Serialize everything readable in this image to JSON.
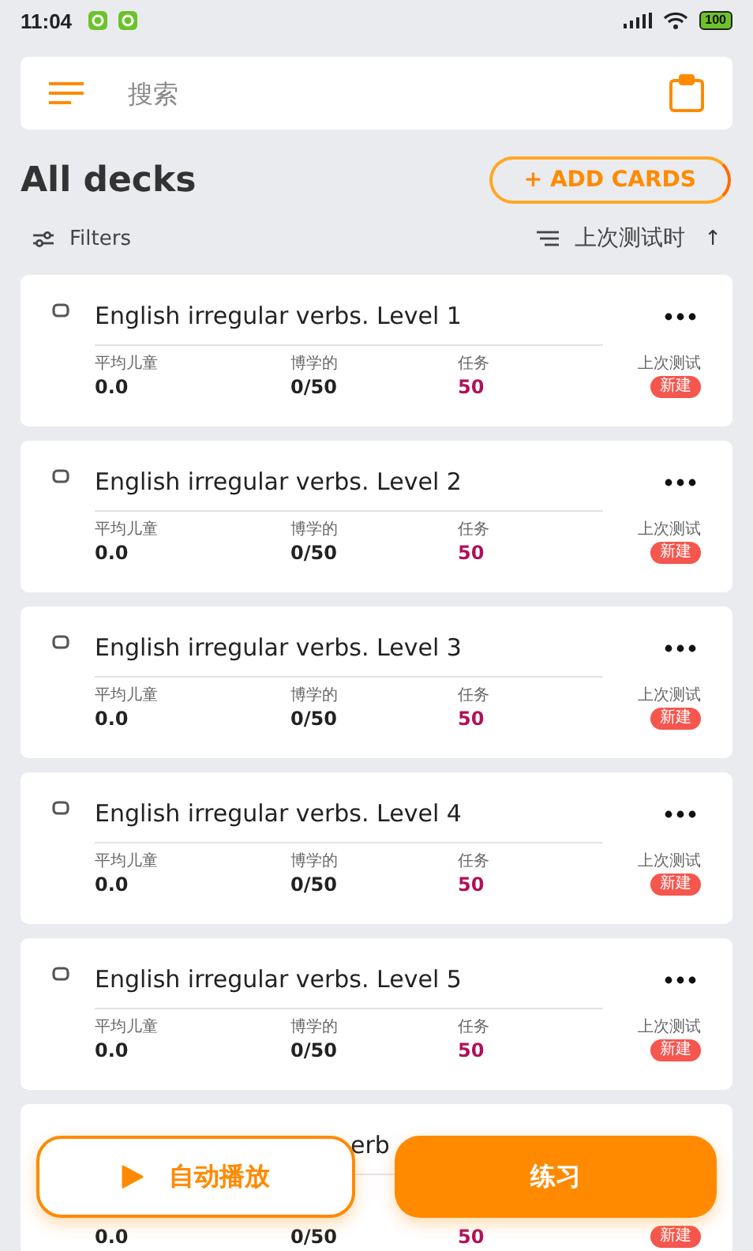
{
  "status_bar": {
    "time": "11:04",
    "battery": "100"
  },
  "search": {
    "placeholder": "搜索"
  },
  "header": {
    "title": "All decks",
    "add_button": "+ ADD CARDS"
  },
  "toolbar": {
    "filters": "Filters",
    "sort": "上次测试时",
    "sort_direction": "↑"
  },
  "decks": [
    {
      "kind": "full",
      "title": "English irregular verbs. Level 1",
      "stats": [
        {
          "label": "平均儿童",
          "value": "0.0"
        },
        {
          "label": "博学的",
          "value": "0/50"
        },
        {
          "label": "任务",
          "value": "50"
        }
      ],
      "last_label": "上次测试",
      "last_badge": "新建"
    },
    {
      "kind": "full",
      "title": "English irregular verbs. Level 2",
      "stats": [
        {
          "label": "平均儿童",
          "value": "0.0"
        },
        {
          "label": "博学的",
          "value": "0/50"
        },
        {
          "label": "任务",
          "value": "50"
        }
      ],
      "last_label": "上次测试",
      "last_badge": "新建"
    },
    {
      "kind": "full",
      "title": "English irregular verbs. Level 3",
      "stats": [
        {
          "label": "平均儿童",
          "value": "0.0"
        },
        {
          "label": "博学的",
          "value": "0/50"
        },
        {
          "label": "任务",
          "value": "50"
        }
      ],
      "last_label": "上次测试",
      "last_badge": "新建"
    },
    {
      "kind": "full",
      "title": "English irregular verbs. Level 4",
      "stats": [
        {
          "label": "平均儿童",
          "value": "0.0"
        },
        {
          "label": "博学的",
          "value": "0/50"
        },
        {
          "label": "任务",
          "value": "50"
        }
      ],
      "last_label": "上次测试",
      "last_badge": "新建"
    },
    {
      "kind": "full",
      "title": "English irregular verbs. Level 5",
      "stats": [
        {
          "label": "平均儿童",
          "value": "0.0"
        },
        {
          "label": "博学的",
          "value": "0/50"
        },
        {
          "label": "任务",
          "value": "50"
        }
      ],
      "last_label": "上次测试",
      "last_badge": "新建"
    },
    {
      "kind": "partial",
      "title": "erb",
      "stats": [
        {
          "value": "0.0"
        },
        {
          "value": "0/50"
        },
        {
          "value": "50"
        }
      ],
      "last_badge": "新建"
    }
  ],
  "actions": {
    "autoplay": "自动播放",
    "practice": "练习"
  }
}
